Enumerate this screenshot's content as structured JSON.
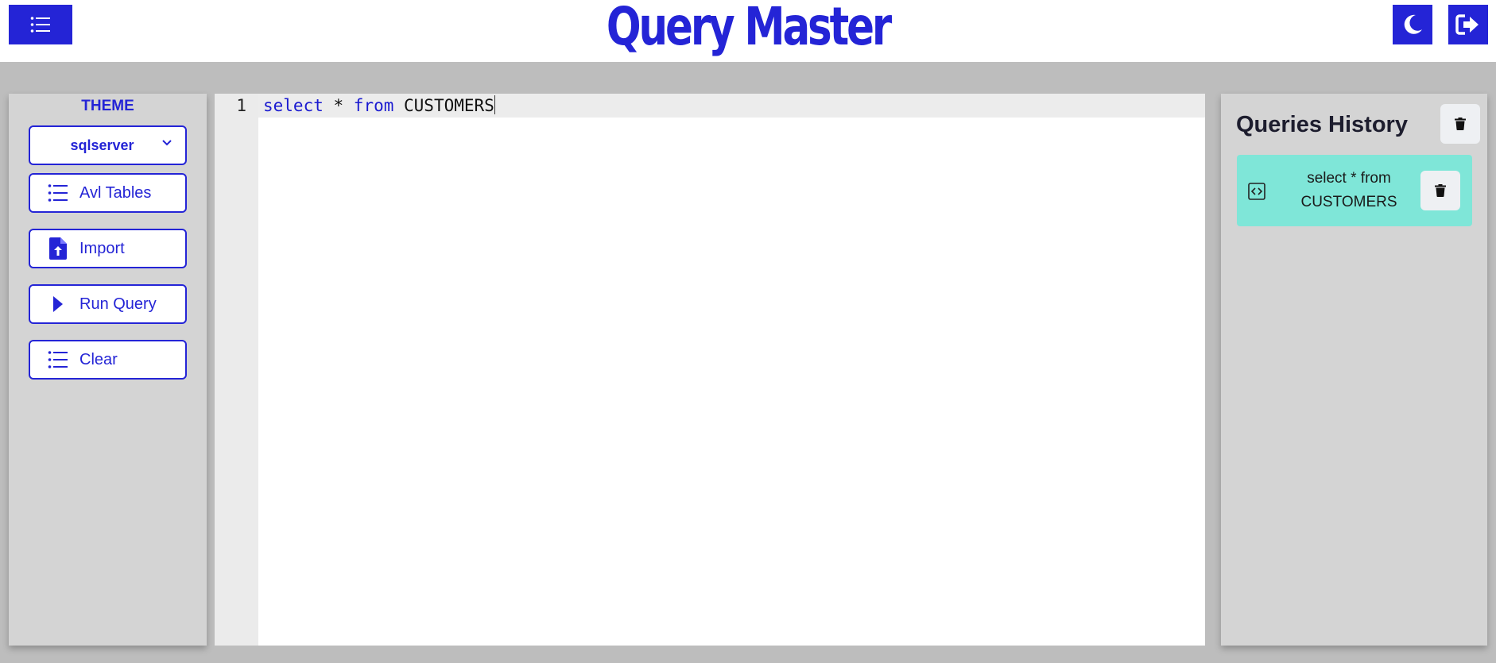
{
  "header": {
    "title": "Query Master",
    "menu_icon": "list-icon",
    "theme_toggle_icon": "moon-icon",
    "logout_icon": "sign-out-icon"
  },
  "sidebar": {
    "theme_label": "THEME",
    "theme_select_value": "sqlserver",
    "buttons": [
      {
        "label": "Avl Tables",
        "icon": "list-icon"
      },
      {
        "label": "Import",
        "icon": "file-upload-icon"
      },
      {
        "label": "Run Query",
        "icon": "play-icon"
      },
      {
        "label": "Clear",
        "icon": "list-icon"
      }
    ]
  },
  "editor": {
    "line_number": "1",
    "tokens": {
      "kw1": "select",
      "t1": " * ",
      "kw2": "from",
      "t2": " CUSTOMERS"
    }
  },
  "history": {
    "title": "Queries History",
    "items": [
      {
        "text": "select * from\nCUSTOMERS"
      }
    ]
  },
  "colors": {
    "brand": "#2424d6",
    "history_item_bg": "#7fe6d8",
    "panel_bg": "#d4d4d4",
    "page_bg": "#bdbdbd"
  }
}
